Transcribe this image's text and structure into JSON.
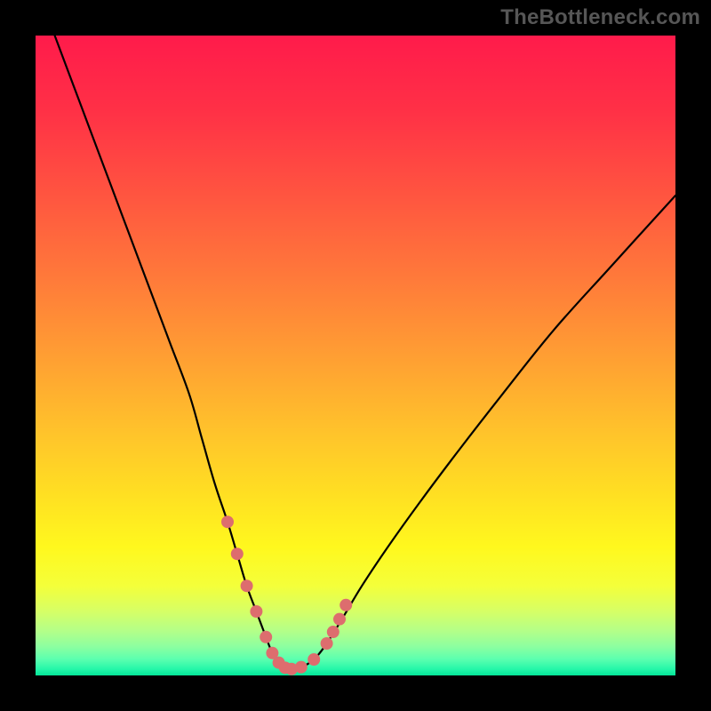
{
  "watermark": {
    "text": "TheBottleneck.com"
  },
  "colors": {
    "frame": "#000000",
    "curve": "#000000",
    "marker": "#dd6d6e",
    "gradient_stops": [
      {
        "offset": 0.0,
        "color": "#ff1b4b"
      },
      {
        "offset": 0.12,
        "color": "#ff3146"
      },
      {
        "offset": 0.25,
        "color": "#ff5540"
      },
      {
        "offset": 0.38,
        "color": "#ff7a3a"
      },
      {
        "offset": 0.5,
        "color": "#ff9e33"
      },
      {
        "offset": 0.62,
        "color": "#ffc32b"
      },
      {
        "offset": 0.72,
        "color": "#ffe022"
      },
      {
        "offset": 0.8,
        "color": "#fff81e"
      },
      {
        "offset": 0.86,
        "color": "#f4ff3a"
      },
      {
        "offset": 0.9,
        "color": "#d6ff66"
      },
      {
        "offset": 0.93,
        "color": "#b4ff88"
      },
      {
        "offset": 0.955,
        "color": "#8cffa0"
      },
      {
        "offset": 0.975,
        "color": "#5affaf"
      },
      {
        "offset": 0.99,
        "color": "#25f7a9"
      },
      {
        "offset": 1.0,
        "color": "#04e598"
      }
    ]
  },
  "chart_data": {
    "type": "line",
    "title": "",
    "xlabel": "",
    "ylabel": "",
    "xlim": [
      0,
      100
    ],
    "ylim": [
      0,
      100
    ],
    "grid": false,
    "series": [
      {
        "name": "bottleneck-curve",
        "x": [
          3,
          6,
          9,
          12,
          15,
          18,
          21,
          24,
          26,
          28,
          30,
          31.5,
          33,
          34.5,
          36,
          37,
          38,
          39,
          40,
          41.5,
          43.5,
          45.5,
          48,
          51,
          55,
          60,
          66,
          73,
          81,
          90,
          100
        ],
        "y": [
          100,
          92,
          84,
          76,
          68,
          60,
          52,
          44,
          37,
          30,
          24,
          19,
          14,
          10,
          6,
          3.5,
          2,
          1.2,
          1,
          1.3,
          2.5,
          5,
          9,
          14,
          20,
          27,
          35,
          44,
          54,
          64,
          75
        ]
      }
    ],
    "markers": {
      "name": "highlight-points",
      "x": [
        30.0,
        31.5,
        33.0,
        34.5,
        36.0,
        37.0,
        38.0,
        39.0,
        40.0,
        41.5,
        43.5,
        45.5,
        46.5,
        47.5,
        48.5
      ],
      "y": [
        24.0,
        19.0,
        14.0,
        10.0,
        6.0,
        3.5,
        2.0,
        1.2,
        1.0,
        1.3,
        2.5,
        5.0,
        6.8,
        8.8,
        11.0
      ],
      "radius": 7
    }
  }
}
